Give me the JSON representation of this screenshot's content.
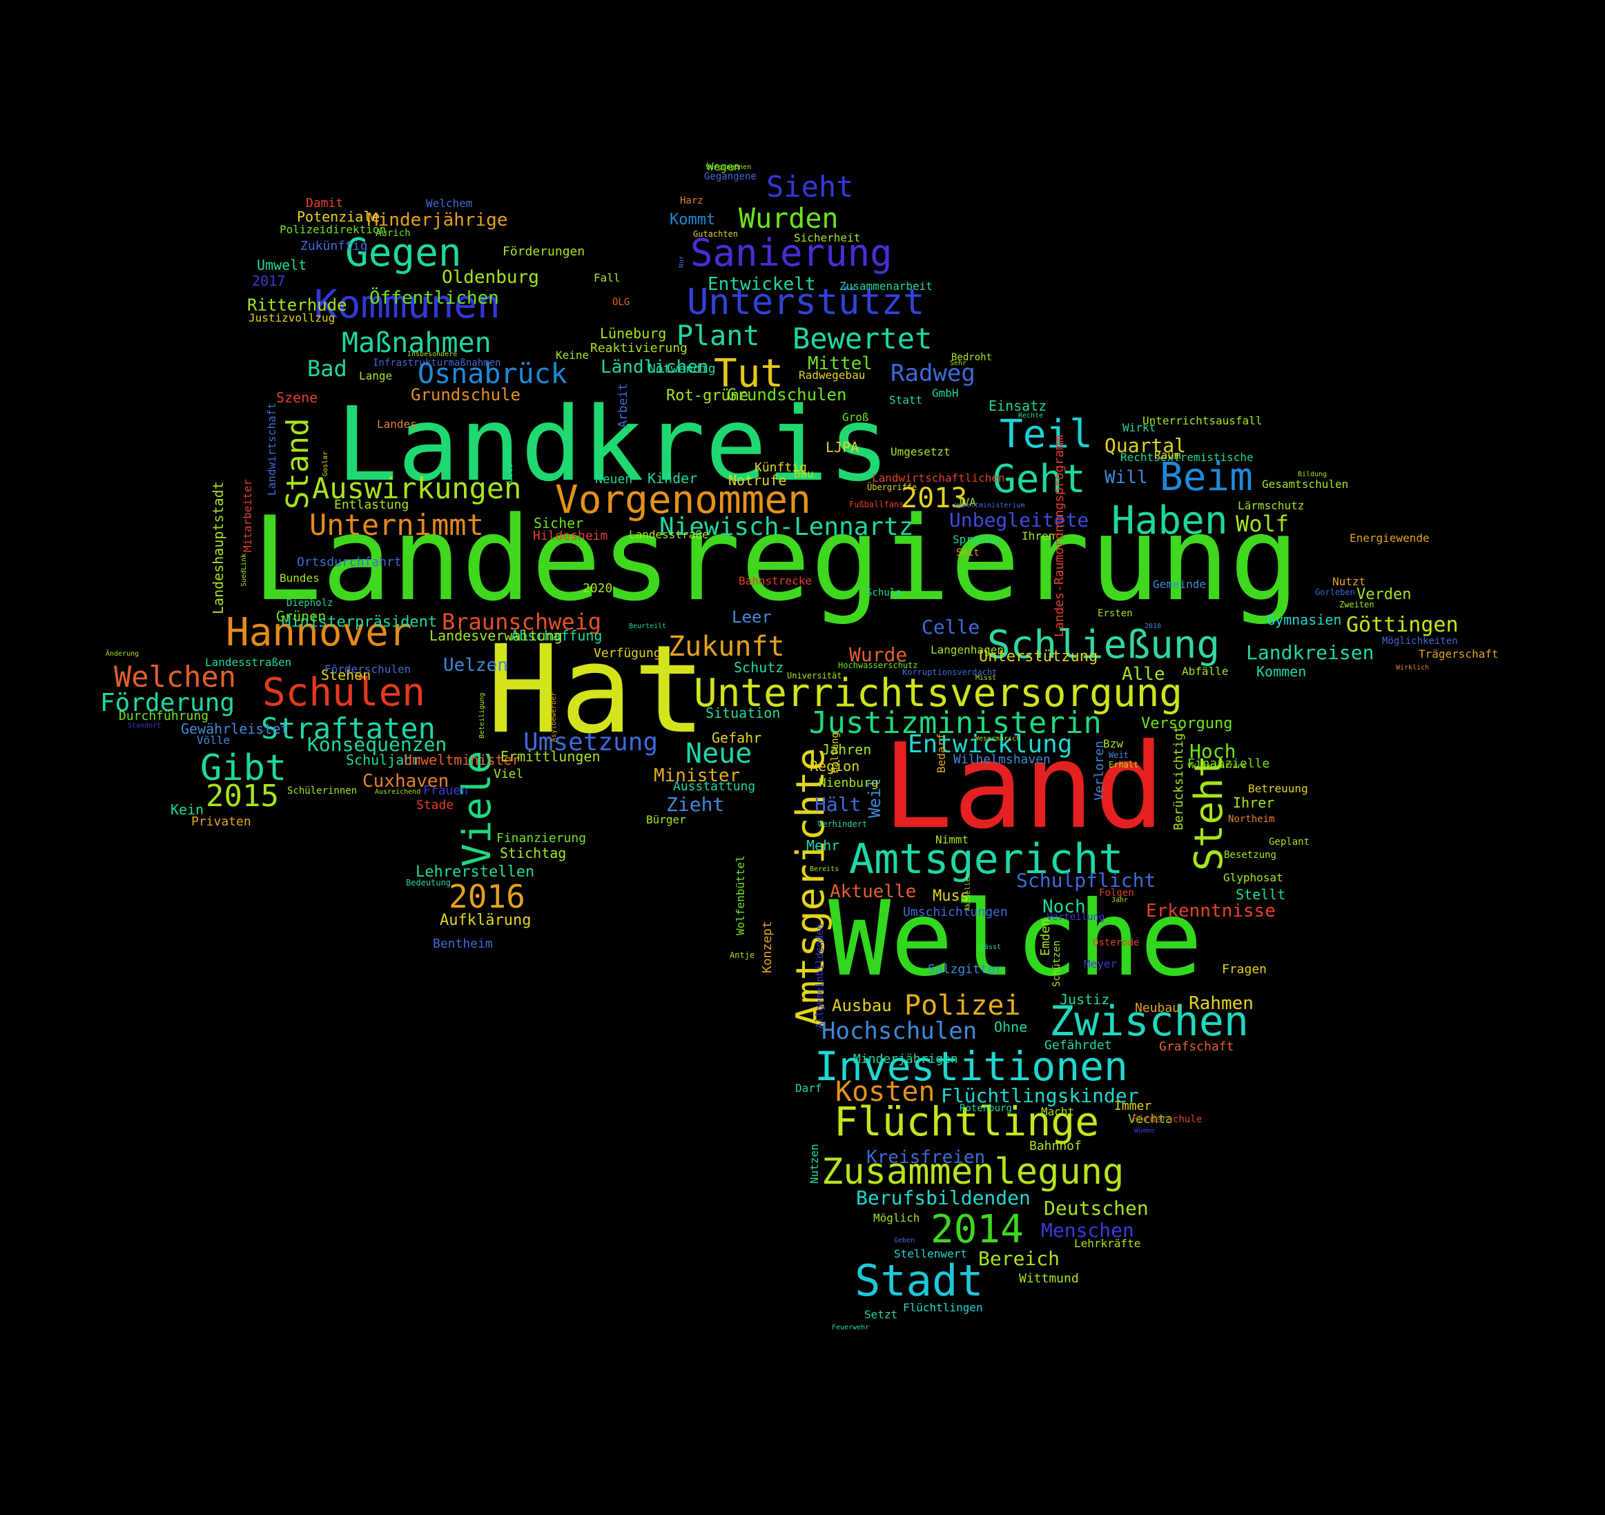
{
  "words": [
    {
      "text": "Landesregierung",
      "color": "#3fd81e"
    },
    {
      "text": "Landkreis",
      "color": "#1fd872"
    },
    {
      "text": "Welche",
      "color": "#32d81e"
    },
    {
      "text": "Hat",
      "color": "#d4e41c"
    },
    {
      "text": "Land",
      "color": "#e42020"
    },
    {
      "text": "Unterrichtsversorgung",
      "color": "#cfe41c"
    },
    {
      "text": "Amtsgerichte",
      "color": "#e4d41c"
    },
    {
      "text": "Amtsgericht",
      "color": "#1fd8a8"
    },
    {
      "text": "Vorgenommen",
      "color": "#e4921c"
    },
    {
      "text": "Niewisch-Lennartz",
      "color": "#1fd8a0"
    },
    {
      "text": "Schließung",
      "color": "#32d8a2"
    },
    {
      "text": "Investitionen",
      "color": "#1fd8d0"
    },
    {
      "text": "Zusammenlegung",
      "color": "#b8e41c"
    },
    {
      "text": "Flüchtlinge",
      "color": "#c8e41c"
    },
    {
      "text": "Zwischen",
      "color": "#1fd8c0"
    },
    {
      "text": "Justizministerin",
      "color": "#1fd880"
    },
    {
      "text": "Sanierung",
      "color": "#4b2cd8"
    },
    {
      "text": "Unterstützt",
      "color": "#3342d8"
    },
    {
      "text": "Kommunen",
      "color": "#3338d8"
    },
    {
      "text": "Hannover",
      "color": "#e48a1c"
    },
    {
      "text": "Schulen",
      "color": "#e43a20"
    },
    {
      "text": "Stadt",
      "color": "#1fc8d8"
    },
    {
      "text": "2014",
      "color": "#3fd81e"
    },
    {
      "text": "Haben",
      "color": "#1fd89a"
    },
    {
      "text": "Beim",
      "color": "#1f8ad8"
    },
    {
      "text": "Teil",
      "color": "#1fd0d8"
    },
    {
      "text": "Geht",
      "color": "#1fd8a0"
    },
    {
      "text": "Steht",
      "color": "#a8e41c"
    },
    {
      "text": "Viele",
      "color": "#1fd880"
    },
    {
      "text": "Tut",
      "color": "#e4c81c"
    },
    {
      "text": "Gegen",
      "color": "#1fd8a0"
    },
    {
      "text": "Wurden",
      "color": "#6ee41c"
    },
    {
      "text": "Sieht",
      "color": "#3338d8"
    },
    {
      "text": "Plant",
      "color": "#1fd8a8"
    },
    {
      "text": "Bewertet",
      "color": "#1fd8a8"
    },
    {
      "text": "Osnabrück",
      "color": "#1f8ad8"
    },
    {
      "text": "Maßnahmen",
      "color": "#1fd8a0"
    },
    {
      "text": "Auswirkungen",
      "color": "#a8e41c"
    },
    {
      "text": "Unternimmt",
      "color": "#e48a1c"
    },
    {
      "text": "Straftaten",
      "color": "#1fd8a8"
    },
    {
      "text": "Gibt",
      "color": "#1fd8a0"
    },
    {
      "text": "2015",
      "color": "#a8e41c"
    },
    {
      "text": "2016",
      "color": "#e4a21c"
    },
    {
      "text": "2013",
      "color": "#e4d41c"
    },
    {
      "text": "Zukunft",
      "color": "#e4a21c"
    },
    {
      "text": "Neue",
      "color": "#1fd8a8"
    },
    {
      "text": "Polizei",
      "color": "#e4b01c"
    },
    {
      "text": "Kosten",
      "color": "#e4921c"
    },
    {
      "text": "Welchen",
      "color": "#e4602c"
    },
    {
      "text": "Förderung",
      "color": "#1fd8a8"
    },
    {
      "text": "Braunschweig",
      "color": "#e4502c"
    },
    {
      "text": "Entwicklung",
      "color": "#1fd8d0"
    },
    {
      "text": "Hochschulen",
      "color": "#3f8ad8"
    },
    {
      "text": "Umsetzung",
      "color": "#3f6ad8"
    },
    {
      "text": "Wolf",
      "color": "#a8e41c"
    },
    {
      "text": "Stand",
      "color": "#a8e41c"
    },
    {
      "text": "Göttingen",
      "color": "#c8e41c"
    },
    {
      "text": "Landkreisen",
      "color": "#1fd8a8"
    },
    {
      "text": "Unbegleitete",
      "color": "#3f4ad8"
    },
    {
      "text": "Radweg",
      "color": "#3f6ad8"
    },
    {
      "text": "Konsequenzen",
      "color": "#1fd8a0"
    },
    {
      "text": "Öffentlichen",
      "color": "#6ee41c"
    },
    {
      "text": "Minderjährige",
      "color": "#e4a21c"
    },
    {
      "text": "Oldenburg",
      "color": "#a8e41c"
    },
    {
      "text": "Quartal",
      "color": "#e4d41c"
    },
    {
      "text": "Schulpflicht",
      "color": "#3f6ad8"
    },
    {
      "text": "Celle",
      "color": "#3f6ad8"
    },
    {
      "text": "Wurde",
      "color": "#e4602c"
    },
    {
      "text": "Aktuelle",
      "color": "#e4602c"
    },
    {
      "text": "Erkenntnisse",
      "color": "#e4402c"
    },
    {
      "text": "Flüchtlingskinder",
      "color": "#1fd8d0"
    },
    {
      "text": "Berufsbildenden",
      "color": "#1fd8d0"
    },
    {
      "text": "Deutschen",
      "color": "#a8e41c"
    },
    {
      "text": "Menschen",
      "color": "#3f38d8"
    },
    {
      "text": "Kreisfreien",
      "color": "#3f6ad8"
    },
    {
      "text": "Entwickelt",
      "color": "#1fd8a8"
    },
    {
      "text": "Kommt",
      "color": "#1f8ad8"
    },
    {
      "text": "Ländlichen",
      "color": "#1fd8a0"
    },
    {
      "text": "Mittel",
      "color": "#6ee41c"
    },
    {
      "text": "Grundschulen",
      "color": "#6ee41c"
    },
    {
      "text": "Grundschule",
      "color": "#e4921c"
    },
    {
      "text": "Bad",
      "color": "#1fd8a0"
    },
    {
      "text": "Uelzen",
      "color": "#3f8ad8"
    },
    {
      "text": "Ministerpräsident",
      "color": "#1fd8a0"
    },
    {
      "text": "Leer",
      "color": "#3f8ad8"
    },
    {
      "text": "Alle",
      "color": "#a8e41c"
    },
    {
      "text": "Hoch",
      "color": "#6ee41c"
    },
    {
      "text": "Hält",
      "color": "#3f6ad8"
    },
    {
      "text": "Noch",
      "color": "#1fd8a0"
    },
    {
      "text": "Bereich",
      "color": "#a8e41c"
    },
    {
      "text": "Rahmen",
      "color": "#e4d41c"
    },
    {
      "text": "Minister",
      "color": "#e4b01c"
    },
    {
      "text": "Zieht",
      "color": "#3f8ad8"
    },
    {
      "text": "Cuxhaven",
      "color": "#e4802c"
    },
    {
      "text": "Einsatz",
      "color": "#1fd8a0"
    },
    {
      "text": "Will",
      "color": "#3f8ad8"
    },
    {
      "text": "Weil",
      "color": "#3f8ad8"
    },
    {
      "text": "Unterstützung",
      "color": "#e4d41c"
    },
    {
      "text": "Versorgung",
      "color": "#6ee41c"
    },
    {
      "text": "Gymnasien",
      "color": "#1fd8d0"
    },
    {
      "text": "Verden",
      "color": "#a8e41c"
    },
    {
      "text": "Kommen",
      "color": "#1fd8a8"
    },
    {
      "text": "Ausbau",
      "color": "#e4d41c"
    },
    {
      "text": "Justiz",
      "color": "#1fd8a0"
    },
    {
      "text": "Ohne",
      "color": "#1fd8a0"
    },
    {
      "text": "Lehrerstellen",
      "color": "#1fd8a0"
    },
    {
      "text": "Aufklärung",
      "color": "#e4d41c"
    },
    {
      "text": "Stellt",
      "color": "#1fd8a0"
    },
    {
      "text": "Ihrer",
      "color": "#a8e41c"
    },
    {
      "text": "Muss",
      "color": "#e4d41c"
    },
    {
      "text": "Mehr",
      "color": "#1fd8a8"
    },
    {
      "text": "Region",
      "color": "#e4d41c"
    },
    {
      "text": "Jahren",
      "color": "#a8e41c"
    },
    {
      "text": "Nienburg",
      "color": "#a8e41c"
    },
    {
      "text": "Ausstattung",
      "color": "#1fd8a8"
    },
    {
      "text": "Verfügung",
      "color": "#e4d41c"
    },
    {
      "text": "Schutz",
      "color": "#1fd8a8"
    },
    {
      "text": "Situation",
      "color": "#1fd8a0"
    },
    {
      "text": "Gefahr",
      "color": "#e4d41c"
    },
    {
      "text": "Finanzielle",
      "color": "#6ee41c"
    },
    {
      "text": "Berücksichtigt",
      "color": "#a8e41c"
    },
    {
      "text": "Verloren",
      "color": "#3f8ad8"
    },
    {
      "text": "Wilhelmshaven",
      "color": "#3f8ad8"
    },
    {
      "text": "Umschichtungen",
      "color": "#3f6ad8"
    },
    {
      "text": "Salzgitter",
      "color": "#3f8ad8"
    },
    {
      "text": "Neubau",
      "color": "#e4a21c"
    },
    {
      "text": "Grafschaft",
      "color": "#e4602c"
    },
    {
      "text": "Gefährdet",
      "color": "#1fd8a0"
    },
    {
      "text": "Immer",
      "color": "#e4d41c"
    },
    {
      "text": "Vechta",
      "color": "#6ee41c"
    },
    {
      "text": "Bahnhof",
      "color": "#a8e41c"
    },
    {
      "text": "Minderjährigen",
      "color": "#1fd8a0"
    },
    {
      "text": "Möglich",
      "color": "#a8e41c"
    },
    {
      "text": "Stellenwert",
      "color": "#1fd8d0"
    },
    {
      "text": "Wittmund",
      "color": "#a8e41c"
    },
    {
      "text": "Lehrkräfte",
      "color": "#a8e41c"
    },
    {
      "text": "Flüchtlingen",
      "color": "#1fd8d0"
    },
    {
      "text": "Setzt",
      "color": "#1fd8a0"
    },
    {
      "text": "Feuerwehr",
      "color": "#1fd8a0"
    },
    {
      "text": "Fragen",
      "color": "#e4d41c"
    },
    {
      "text": "Glyphosat",
      "color": "#a8e41c"
    },
    {
      "text": "Besetzung",
      "color": "#a8e41c"
    },
    {
      "text": "Geplant",
      "color": "#a8e41c"
    },
    {
      "text": "Northeim",
      "color": "#e4802c"
    },
    {
      "text": "Betreuung",
      "color": "#e4d41c"
    },
    {
      "text": "Bzw",
      "color": "#a8e41c"
    },
    {
      "text": "Weit",
      "color": "#3f8ad8"
    },
    {
      "text": "Erhalt",
      "color": "#a8e41c"
    },
    {
      "text": "Bedarf",
      "color": "#e4a21c"
    },
    {
      "text": "Nimmt",
      "color": "#a8e41c"
    },
    {
      "text": "Verhindert",
      "color": "#1fd8a0"
    },
    {
      "text": "Bereits",
      "color": "#a8e41c"
    },
    {
      "text": "Konzept",
      "color": "#e4a21c"
    },
    {
      "text": "Allgemeinbildenden",
      "color": "#3f38d8"
    },
    {
      "text": "Wolfenbüttel",
      "color": "#6ee41c"
    },
    {
      "text": "Antje",
      "color": "#a8e41c"
    },
    {
      "text": "Haltung",
      "color": "#e4d41c"
    },
    {
      "text": "Hochwasserschutz",
      "color": "#6ee41c"
    },
    {
      "text": "Universität",
      "color": "#a8e41c"
    },
    {
      "text": "Korruptionsverdacht",
      "color": "#3f6ad8"
    },
    {
      "text": "Langenhagen",
      "color": "#a8e41c"
    },
    {
      "text": "Misst",
      "color": "#a8e41c"
    },
    {
      "text": "Landes-Raumordnungsprogramm",
      "color": "#e4402c"
    },
    {
      "text": "Gemeinde",
      "color": "#3f8ad8"
    },
    {
      "text": "Ersten",
      "color": "#a8e41c"
    },
    {
      "text": "2018",
      "color": "#3f8ad8"
    },
    {
      "text": "Nutzt",
      "color": "#e4a21c"
    },
    {
      "text": "Gorleben",
      "color": "#3f6ad8"
    },
    {
      "text": "Zweiten",
      "color": "#a8e41c"
    },
    {
      "text": "Möglichkeiten",
      "color": "#3f6ad8"
    },
    {
      "text": "Trägerschaft",
      "color": "#e4a21c"
    },
    {
      "text": "Wirklich",
      "color": "#e4802c"
    },
    {
      "text": "Abfälle",
      "color": "#a8e41c"
    },
    {
      "text": "Schule",
      "color": "#1fd8a8"
    },
    {
      "text": "Bahnstrecke",
      "color": "#e4402c"
    },
    {
      "text": "Seit",
      "color": "#e4a21c"
    },
    {
      "text": "Sprache",
      "color": "#1fd8a0"
    },
    {
      "text": "Ihren",
      "color": "#a8e41c"
    },
    {
      "text": "Energiewende",
      "color": "#e4a21c"
    },
    {
      "text": "Lärmschutz",
      "color": "#a8e41c"
    },
    {
      "text": "Gesamtschulen",
      "color": "#a8e41c"
    },
    {
      "text": "Bildung",
      "color": "#a8e41c"
    },
    {
      "text": "JVA",
      "color": "#a8e41c"
    },
    {
      "text": "Landwirtschaftlichen",
      "color": "#e4402c"
    },
    {
      "text": "Umweltministerium",
      "color": "#3f6ad8"
    },
    {
      "text": "Rechtsextremistische",
      "color": "#1fd8a0"
    },
    {
      "text": "Wirkt",
      "color": "#1fd8a0"
    },
    {
      "text": "Raum",
      "color": "#e4d41c"
    },
    {
      "text": "Unterrichtsausfall",
      "color": "#a8e41c"
    },
    {
      "text": "Rechte",
      "color": "#1fd8a0"
    },
    {
      "text": "Umgesetzt",
      "color": "#a8e41c"
    },
    {
      "text": "Bau",
      "color": "#a8e41c"
    },
    {
      "text": "Fußballfans",
      "color": "#e4402c"
    },
    {
      "text": "Übergriffe",
      "color": "#e4d41c"
    },
    {
      "text": "LJPA",
      "color": "#e4d41c"
    },
    {
      "text": "Groß",
      "color": "#6ee41c"
    },
    {
      "text": "Statt",
      "color": "#1fd8a0"
    },
    {
      "text": "GmbH",
      "color": "#1fd8a0"
    },
    {
      "text": "Bedroht",
      "color": "#a8e41c"
    },
    {
      "text": "Sehr",
      "color": "#a8e41c"
    },
    {
      "text": "Radwegebau",
      "color": "#e4d41c"
    },
    {
      "text": "Zusammenarbeit",
      "color": "#1fd8a0"
    },
    {
      "text": "Sicherheit",
      "color": "#a8e41c"
    },
    {
      "text": "Gutachten",
      "color": "#e4d41c"
    },
    {
      "text": "Harz",
      "color": "#e4802c"
    },
    {
      "text": "Gegangene",
      "color": "#3f6ad8"
    },
    {
      "text": "Vergangenen",
      "color": "#a8e41c"
    },
    {
      "text": "Wegen",
      "color": "#6ee41c"
    },
    {
      "text": "Nur",
      "color": "#3f6ad8"
    },
    {
      "text": "Fall",
      "color": "#a8e41c"
    },
    {
      "text": "OLG",
      "color": "#e4602c"
    },
    {
      "text": "Lüneburg",
      "color": "#a8e41c"
    },
    {
      "text": "Reaktivierung",
      "color": "#a8e41c"
    },
    {
      "text": "Keine",
      "color": "#a8e41c"
    },
    {
      "text": "Notwendig",
      "color": "#1fd8a0"
    },
    {
      "text": "Rot-grüne",
      "color": "#a8e41c"
    },
    {
      "text": "Arbeit",
      "color": "#3f6ad8"
    },
    {
      "text": "Künftig",
      "color": "#e4d41c"
    },
    {
      "text": "Notrufe",
      "color": "#e4d41c"
    },
    {
      "text": "Kinder",
      "color": "#1fd8a8"
    },
    {
      "text": "Neuen",
      "color": "#1fd8a0"
    },
    {
      "text": "Lies",
      "color": "#1fd8a0"
    },
    {
      "text": "Insbesondere",
      "color": "#a8e41c"
    },
    {
      "text": "Infrastrukturmaßnahmen",
      "color": "#3f6ad8"
    },
    {
      "text": "Lange",
      "color": "#a8e41c"
    },
    {
      "text": "Szene",
      "color": "#e4402c"
    },
    {
      "text": "Landes",
      "color": "#e4802c"
    },
    {
      "text": "Goslar",
      "color": "#e4d41c"
    },
    {
      "text": "Entlastung",
      "color": "#a8e41c"
    },
    {
      "text": "Landwirtschaft",
      "color": "#3f6ad8"
    },
    {
      "text": "Sicher",
      "color": "#6ee41c"
    },
    {
      "text": "Hildesheim",
      "color": "#e4402c"
    },
    {
      "text": "Landesstraße",
      "color": "#a8e41c"
    },
    {
      "text": "2020",
      "color": "#a8e41c"
    },
    {
      "text": "Beurteilt",
      "color": "#1fd8a0"
    },
    {
      "text": "Abschaffung",
      "color": "#1fd8a0"
    },
    {
      "text": "Landesverwaltung",
      "color": "#a8e41c"
    },
    {
      "text": "Ortsdurchfahrt",
      "color": "#3f6ad8"
    },
    {
      "text": "Diepholz",
      "color": "#1fd8a0"
    },
    {
      "text": "Mitarbeiter",
      "color": "#e4402c"
    },
    {
      "text": "SuedLink",
      "color": "#a8e41c"
    },
    {
      "text": "Landeshauptstadt",
      "color": "#a8e41c"
    },
    {
      "text": "Bundes",
      "color": "#a8e41c"
    },
    {
      "text": "Grünen",
      "color": "#6ee41c"
    },
    {
      "text": "Stehen",
      "color": "#e4d41c"
    },
    {
      "text": "Förderschulen",
      "color": "#3f6ad8"
    },
    {
      "text": "Landesstraßen",
      "color": "#1fd8a0"
    },
    {
      "text": "Änderung",
      "color": "#a8e41c"
    },
    {
      "text": "Durchführung",
      "color": "#6ee41c"
    },
    {
      "text": "Standort",
      "color": "#3f38d8"
    },
    {
      "text": "Gewährleistet",
      "color": "#3f8ad8"
    },
    {
      "text": "Völle",
      "color": "#3f8ad8"
    },
    {
      "text": "Schuljahr",
      "color": "#1fd8a0"
    },
    {
      "text": "Umweltminister",
      "color": "#e4602c"
    },
    {
      "text": "Ermittlungen",
      "color": "#a8e41c"
    },
    {
      "text": "Viel",
      "color": "#a8e41c"
    },
    {
      "text": "Asylbewerber",
      "color": "#e4a21c"
    },
    {
      "text": "Beteiligung",
      "color": "#a8e41c"
    },
    {
      "text": "Schülerinnen",
      "color": "#a8e41c"
    },
    {
      "text": "Ausreichend",
      "color": "#a8e41c"
    },
    {
      "text": "Frauen",
      "color": "#3f38d8"
    },
    {
      "text": "Stade",
      "color": "#e4402c"
    },
    {
      "text": "Kein",
      "color": "#1fd8a0"
    },
    {
      "text": "Privaten",
      "color": "#e4a21c"
    },
    {
      "text": "Finanzierung",
      "color": "#6ee41c"
    },
    {
      "text": "Stichtag",
      "color": "#a8e41c"
    },
    {
      "text": "Bedeutung",
      "color": "#1fd8a0"
    },
    {
      "text": "Bentheim",
      "color": "#3f6ad8"
    },
    {
      "text": "Bürger",
      "color": "#a8e41c"
    },
    {
      "text": "Damit",
      "color": "#e4402c"
    },
    {
      "text": "Welchem",
      "color": "#3f6ad8"
    },
    {
      "text": "Potenziale",
      "color": "#e4d41c"
    },
    {
      "text": "Polizeidirektion",
      "color": "#6ee41c"
    },
    {
      "text": "Aurich",
      "color": "#6ee41c"
    },
    {
      "text": "Zukünftig",
      "color": "#3f6ad8"
    },
    {
      "text": "Förderungen",
      "color": "#a8e41c"
    },
    {
      "text": "Umwelt",
      "color": "#1fd8a0"
    },
    {
      "text": "2017",
      "color": "#3f38d8"
    },
    {
      "text": "Ritterhude",
      "color": "#a8e41c"
    },
    {
      "text": "Justizvollzug",
      "color": "#e4d41c"
    },
    {
      "text": "Darf",
      "color": "#1fd8a0"
    },
    {
      "text": "Rotenburg",
      "color": "#1fd8a0"
    },
    {
      "text": "Macht",
      "color": "#a8e41c"
    },
    {
      "text": "Förderschule",
      "color": "#e4402c"
    },
    {
      "text": "Wümme",
      "color": "#3f38d8"
    },
    {
      "text": "Nutzen",
      "color": "#1fd8a0"
    },
    {
      "text": "Geben",
      "color": "#3f6ad8"
    },
    {
      "text": "Meyer",
      "color": "#3f38d8"
    },
    {
      "text": "Osterode",
      "color": "#e4402c"
    },
    {
      "text": "Folgen",
      "color": "#e4402c"
    },
    {
      "text": "Jahr",
      "color": "#a8e41c"
    },
    {
      "text": "Aktuellen",
      "color": "#a8e41c"
    },
    {
      "text": "Lässt",
      "color": "#1fd8a0"
    },
    {
      "text": "Emden",
      "color": "#a8e41c"
    },
    {
      "text": "Schützen",
      "color": "#a8e41c"
    },
    {
      "text": "Verteilung",
      "color": "#3f38d8"
    },
    {
      "text": "Wesermarsch",
      "color": "#a8e41c"
    },
    {
      "text": "VW-Abgasaffäre",
      "color": "#a8e41c"
    },
    {
      "text": "Bundesamt",
      "color": "#a8e41c"
    },
    {
      "text": "Statistische",
      "color": "#3f38d8"
    }
  ]
}
